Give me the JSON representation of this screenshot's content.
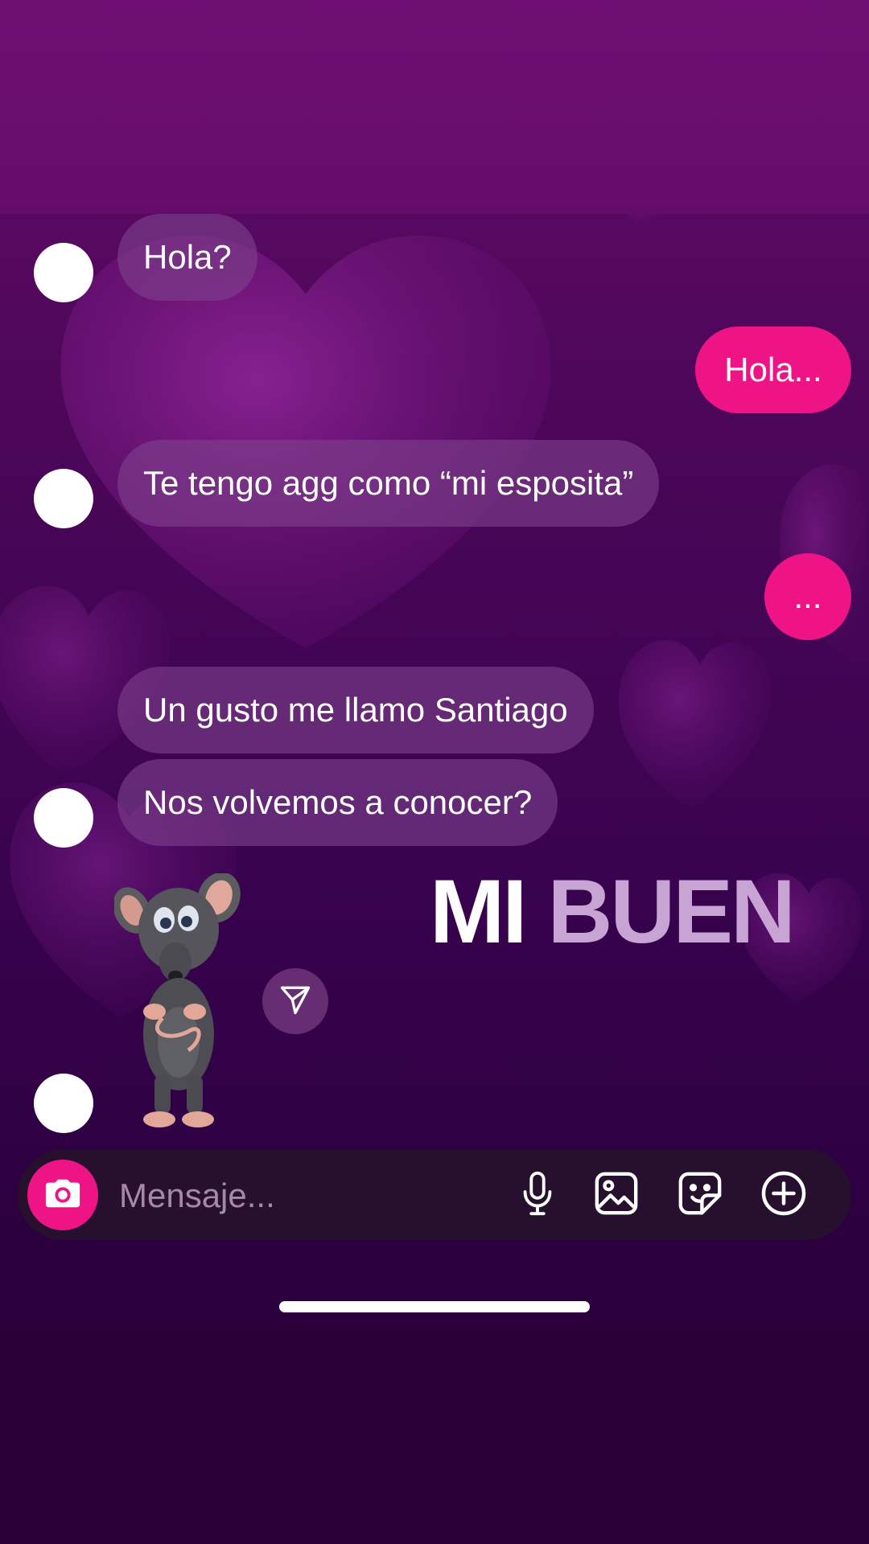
{
  "chat": {
    "messages": [
      {
        "id": "m1",
        "side": "incoming",
        "text": "Hola?"
      },
      {
        "id": "m2",
        "side": "outgoing",
        "text": "Hola..."
      },
      {
        "id": "m3",
        "side": "incoming",
        "text": "Te tengo agg como “mi esposita”"
      },
      {
        "id": "m4",
        "side": "outgoing",
        "text": "..."
      },
      {
        "id": "m5",
        "side": "incoming",
        "text": "Un gusto me llamo Santiago"
      },
      {
        "id": "m6",
        "side": "incoming",
        "text": "Nos volvemos a conocer?"
      }
    ],
    "sticker": {
      "icon": "mouse-sticker"
    }
  },
  "overlay": {
    "word1": "MI",
    "word2": "BUEN"
  },
  "composer": {
    "placeholder": "Mensaje...",
    "value": "",
    "icons": [
      "camera-icon",
      "microphone-icon",
      "gallery-icon",
      "sticker-icon",
      "plus-icon"
    ]
  },
  "colors": {
    "accent": "#ee1486",
    "incoming_bubble": "#7e408c",
    "background": "#3a0350"
  }
}
